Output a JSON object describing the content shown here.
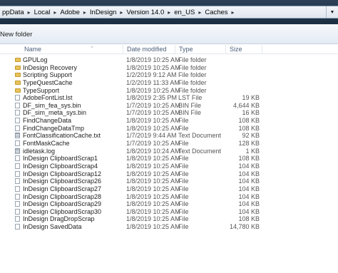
{
  "breadcrumb": [
    "ppData",
    "Local",
    "Adobe",
    "InDesign",
    "Version 14.0",
    "en_US",
    "Caches"
  ],
  "toolbar": {
    "new_folder": "New folder"
  },
  "columns": {
    "name": "Name",
    "date": "Date modified",
    "type": "Type",
    "size": "Size"
  },
  "files": [
    {
      "icon": "folder-icon",
      "name": "GPULog",
      "date": "1/8/2019 10:25 AM",
      "type": "File folder",
      "size": ""
    },
    {
      "icon": "folder-icon",
      "name": "InDesign Recovery",
      "date": "1/8/2019 10:25 AM",
      "type": "File folder",
      "size": ""
    },
    {
      "icon": "folder-icon",
      "name": "Scripting Support",
      "date": "1/2/2019 9:12 AM",
      "type": "File folder",
      "size": ""
    },
    {
      "icon": "folder-icon",
      "name": "TypeQuestCache",
      "date": "1/2/2019 11:33 AM",
      "type": "File folder",
      "size": ""
    },
    {
      "icon": "folder-icon",
      "name": "TypeSupport",
      "date": "1/8/2019 10:25 AM",
      "type": "File folder",
      "size": ""
    },
    {
      "icon": "file-icon",
      "name": "AdobeFontList.lst",
      "date": "1/8/2019 2:35 PM",
      "type": "LST File",
      "size": "19 KB"
    },
    {
      "icon": "file-icon",
      "name": "DF_sim_fea_sys.bin",
      "date": "1/7/2019 10:25 AM",
      "type": "BIN File",
      "size": "4,644 KB"
    },
    {
      "icon": "file-icon",
      "name": "DF_sim_meta_sys.bin",
      "date": "1/7/2019 10:25 AM",
      "type": "BIN File",
      "size": "16 KB"
    },
    {
      "icon": "file-icon",
      "name": "FindChangeData",
      "date": "1/8/2019 10:25 AM",
      "type": "File",
      "size": "108 KB"
    },
    {
      "icon": "file-icon",
      "name": "FindChangeDataTmp",
      "date": "1/8/2019 10:25 AM",
      "type": "File",
      "size": "108 KB"
    },
    {
      "icon": "doc-icon",
      "name": "FontClassificationCache.txt",
      "date": "1/7/2019 9:44 AM",
      "type": "Text Document",
      "size": "92 KB"
    },
    {
      "icon": "file-icon",
      "name": "FontMaskCache",
      "date": "1/7/2019 10:25 AM",
      "type": "File",
      "size": "128 KB"
    },
    {
      "icon": "doc-icon",
      "name": "idletask.log",
      "date": "1/8/2019 10:24 AM",
      "type": "Text Document",
      "size": "1 KB"
    },
    {
      "icon": "file-icon",
      "name": "InDesign ClipboardScrap1",
      "date": "1/8/2019 10:25 AM",
      "type": "File",
      "size": "108 KB"
    },
    {
      "icon": "file-icon",
      "name": "InDesign ClipboardScrap4",
      "date": "1/8/2019 10:25 AM",
      "type": "File",
      "size": "104 KB"
    },
    {
      "icon": "file-icon",
      "name": "InDesign ClipboardScrap12",
      "date": "1/8/2019 10:25 AM",
      "type": "File",
      "size": "104 KB"
    },
    {
      "icon": "file-icon",
      "name": "InDesign ClipboardScrap26",
      "date": "1/8/2019 10:25 AM",
      "type": "File",
      "size": "104 KB"
    },
    {
      "icon": "file-icon",
      "name": "InDesign ClipboardScrap27",
      "date": "1/8/2019 10:25 AM",
      "type": "File",
      "size": "104 KB"
    },
    {
      "icon": "file-icon",
      "name": "InDesign ClipboardScrap28",
      "date": "1/8/2019 10:25 AM",
      "type": "File",
      "size": "104 KB"
    },
    {
      "icon": "file-icon",
      "name": "InDesign ClipboardScrap29",
      "date": "1/8/2019 10:25 AM",
      "type": "File",
      "size": "104 KB"
    },
    {
      "icon": "file-icon",
      "name": "InDesign ClipboardScrap30",
      "date": "1/8/2019 10:25 AM",
      "type": "File",
      "size": "104 KB"
    },
    {
      "icon": "file-icon",
      "name": "InDesign DragDropScrap",
      "date": "1/8/2019 10:25 AM",
      "type": "File",
      "size": "108 KB"
    },
    {
      "icon": "file-icon",
      "name": "InDesign SavedData",
      "date": "1/8/2019 10:25 AM",
      "type": "File",
      "size": "14,780 KB"
    }
  ],
  "colors": {
    "address_bar": "#22364a",
    "folder": "#e8c25b",
    "header_text": "#4c607a"
  }
}
